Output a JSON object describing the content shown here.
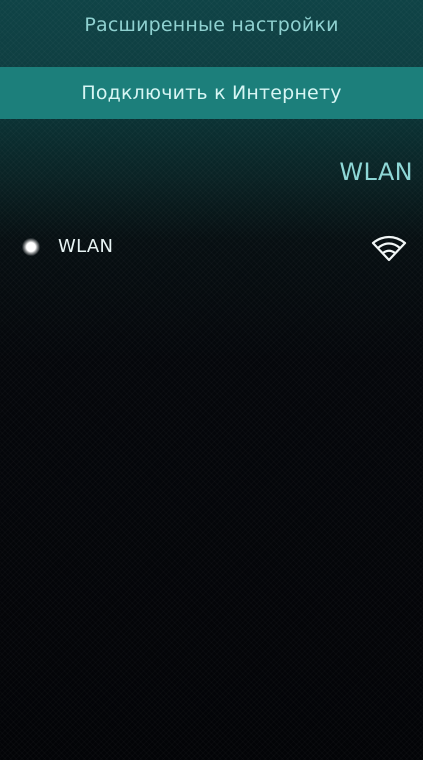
{
  "menu": {
    "advanced_label": "Расширенные настройки",
    "connect_label": "Подключить к Интернету"
  },
  "page": {
    "section_title": "WLAN"
  },
  "networks": [
    {
      "name": "WLAN",
      "icon": "wifi-signal-icon",
      "status_icon": "connected-dot-icon"
    }
  ],
  "colors": {
    "accent": "#1c7f7b",
    "accent_text": "#8ed7d6",
    "background_dark": "#030407"
  }
}
